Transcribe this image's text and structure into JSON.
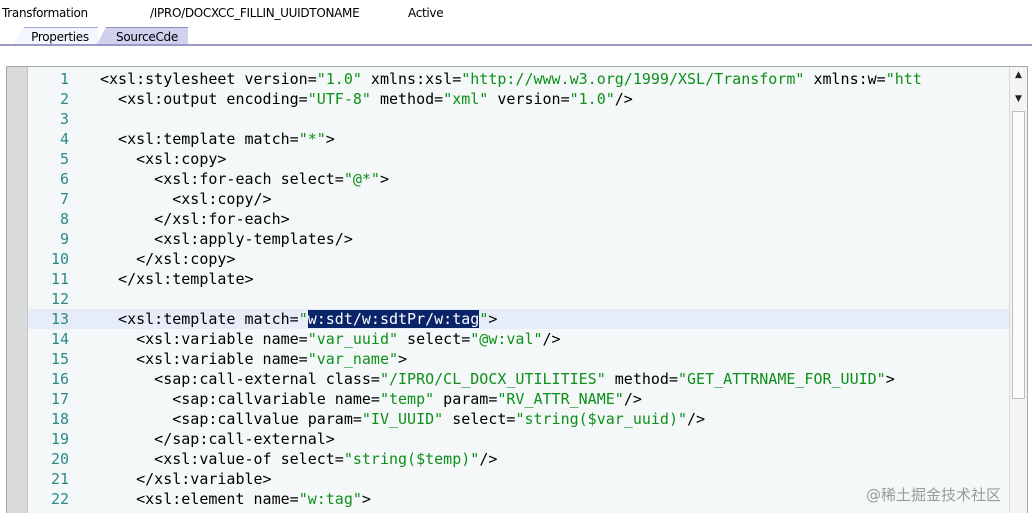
{
  "header": {
    "type_label": "Transformation",
    "name": "/IPRO/DOCXCC_FILLIN_UUIDTONAME",
    "status": "Active"
  },
  "tabs": [
    {
      "label": "Properties",
      "active": false
    },
    {
      "label": "SourceCde",
      "active": true
    }
  ],
  "editor": {
    "current_line": 13,
    "selected_text": "w:sdt/w:sdtPr/w:tag",
    "lines": [
      {
        "n": "1",
        "parts": [
          [
            "t",
            "<xsl:stylesheet version="
          ],
          [
            "s",
            "\"1.0\""
          ],
          [
            "t",
            " xmlns:xsl="
          ],
          [
            "s",
            "\"http://www.w3.org/1999/XSL/Transform\""
          ],
          [
            "t",
            " xmlns:w="
          ],
          [
            "s",
            "\"htt"
          ]
        ]
      },
      {
        "n": "2",
        "parts": [
          [
            "t",
            "  <xsl:output encoding="
          ],
          [
            "s",
            "\"UTF-8\""
          ],
          [
            "t",
            " method="
          ],
          [
            "s",
            "\"xml\""
          ],
          [
            "t",
            " version="
          ],
          [
            "s",
            "\"1.0\""
          ],
          [
            "t",
            "/>"
          ]
        ]
      },
      {
        "n": "3",
        "parts": []
      },
      {
        "n": "4",
        "parts": [
          [
            "t",
            "  <xsl:template match="
          ],
          [
            "s",
            "\"*\""
          ],
          [
            "t",
            ">"
          ]
        ]
      },
      {
        "n": "5",
        "parts": [
          [
            "t",
            "    <xsl:copy>"
          ]
        ]
      },
      {
        "n": "6",
        "parts": [
          [
            "t",
            "      <xsl:for-each select="
          ],
          [
            "s",
            "\"@*\""
          ],
          [
            "t",
            ">"
          ]
        ]
      },
      {
        "n": "7",
        "parts": [
          [
            "t",
            "        <xsl:copy/>"
          ]
        ]
      },
      {
        "n": "8",
        "parts": [
          [
            "t",
            "      </xsl:for-each>"
          ]
        ]
      },
      {
        "n": "9",
        "parts": [
          [
            "t",
            "      <xsl:apply-templates/>"
          ]
        ]
      },
      {
        "n": "10",
        "parts": [
          [
            "t",
            "    </xsl:copy>"
          ]
        ]
      },
      {
        "n": "11",
        "parts": [
          [
            "t",
            "  </xsl:template>"
          ]
        ]
      },
      {
        "n": "12",
        "parts": []
      },
      {
        "n": "13",
        "parts": [
          [
            "t",
            "  <xsl:template match="
          ],
          [
            "s",
            "\""
          ],
          [
            "sel",
            "w:sdt/w:sdtPr/w:tag"
          ],
          [
            "s",
            "\""
          ],
          [
            "t",
            ">"
          ]
        ]
      },
      {
        "n": "14",
        "parts": [
          [
            "t",
            "    <xsl:variable name="
          ],
          [
            "s",
            "\"var_uuid\""
          ],
          [
            "t",
            " select="
          ],
          [
            "s",
            "\"@w:val\""
          ],
          [
            "t",
            "/>"
          ]
        ]
      },
      {
        "n": "15",
        "parts": [
          [
            "t",
            "    <xsl:variable name="
          ],
          [
            "s",
            "\"var_name\""
          ],
          [
            "t",
            ">"
          ]
        ]
      },
      {
        "n": "16",
        "parts": [
          [
            "t",
            "      <sap:call-external class="
          ],
          [
            "s",
            "\"/IPRO/CL_DOCX_UTILITIES\""
          ],
          [
            "t",
            " method="
          ],
          [
            "s",
            "\"GET_ATTRNAME_FOR_UUID\""
          ],
          [
            "t",
            ">"
          ]
        ]
      },
      {
        "n": "17",
        "parts": [
          [
            "t",
            "        <sap:callvariable name="
          ],
          [
            "s",
            "\"temp\""
          ],
          [
            "t",
            " param="
          ],
          [
            "s",
            "\"RV_ATTR_NAME\""
          ],
          [
            "t",
            "/>"
          ]
        ]
      },
      {
        "n": "18",
        "parts": [
          [
            "t",
            "        <sap:callvalue param="
          ],
          [
            "s",
            "\"IV_UUID\""
          ],
          [
            "t",
            " select="
          ],
          [
            "s",
            "\"string($var_uuid)\""
          ],
          [
            "t",
            "/>"
          ]
        ]
      },
      {
        "n": "19",
        "parts": [
          [
            "t",
            "      </sap:call-external>"
          ]
        ]
      },
      {
        "n": "20",
        "parts": [
          [
            "t",
            "      <xsl:value-of select="
          ],
          [
            "s",
            "\"string($temp)\""
          ],
          [
            "t",
            "/>"
          ]
        ]
      },
      {
        "n": "21",
        "parts": [
          [
            "t",
            "    </xsl:variable>"
          ]
        ]
      },
      {
        "n": "22",
        "parts": [
          [
            "t",
            "    <xsl:element name="
          ],
          [
            "s",
            "\"w:tag\""
          ],
          [
            "t",
            ">"
          ]
        ]
      }
    ]
  },
  "scrollbar": {
    "up_icon": "▲",
    "down_icon": "▼"
  },
  "watermark": "@稀土掘金技术社区",
  "colors": {
    "string": "#0f8f1a",
    "line_number": "#2a8a88",
    "selection": "#0a246a",
    "current_line": "#e6edf8"
  }
}
